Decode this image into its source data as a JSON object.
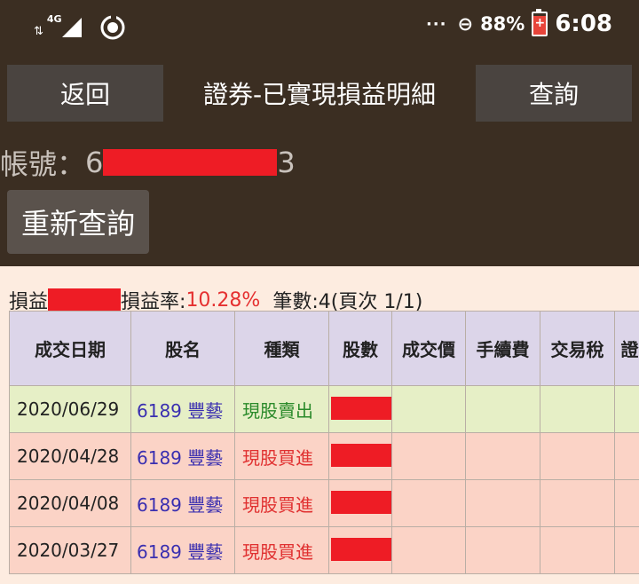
{
  "status_bar": {
    "network": "4G",
    "battery_percent": "88%",
    "battery_level": 0.88,
    "time": "6:08",
    "more": "···",
    "dnd": "⊖"
  },
  "header": {
    "back_label": "返回",
    "title": "證券-已實現損益明細",
    "query_label": "查詢"
  },
  "account": {
    "label": "帳號：",
    "prefix": "6",
    "suffix": "3"
  },
  "requery_label": "重新查詢",
  "summary": {
    "pnl_label": "損益",
    "rate_label": "損益率:",
    "rate_value": "10.28%",
    "count_text": "筆數:4(頁次 1/1)"
  },
  "table": {
    "headers": [
      "成交日期",
      "股名",
      "種類",
      "股數",
      "成交價",
      "手續費",
      "交易稅",
      "證"
    ],
    "rows": [
      {
        "date": "2020/06/29",
        "stock": "6189 豐藝",
        "kind": "現股賣出",
        "type": "sell"
      },
      {
        "date": "2020/04/28",
        "stock": "6189 豐藝",
        "kind": "現股買進",
        "type": "buy"
      },
      {
        "date": "2020/04/08",
        "stock": "6189 豐藝",
        "kind": "現股買進",
        "type": "buy"
      },
      {
        "date": "2020/03/27",
        "stock": "6189 豐藝",
        "kind": "現股買進",
        "type": "buy"
      }
    ]
  },
  "colors": {
    "background": "#3b2e22",
    "panel": "#fdece0",
    "header_row": "#dcd5e9",
    "sell_row": "#e6efc6",
    "buy_row": "#fbd3c6",
    "redaction": "#ee1c25",
    "rate": "#e53030"
  },
  "icons": [
    "network-signal-icon",
    "sync-icon",
    "more-icon",
    "do-not-disturb-icon",
    "battery-icon"
  ]
}
